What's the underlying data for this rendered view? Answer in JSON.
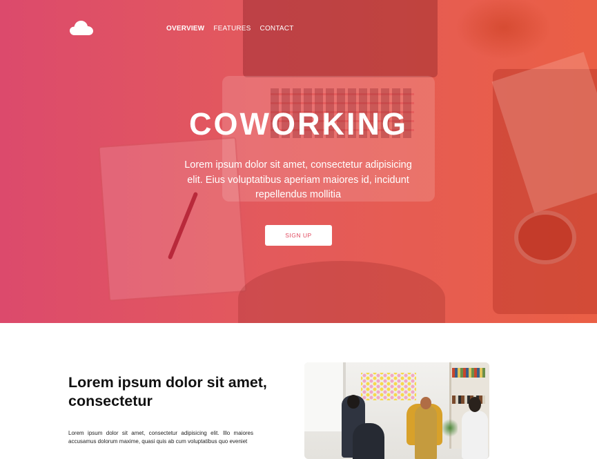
{
  "nav": {
    "logo_icon": "cloud-icon",
    "items": [
      {
        "label": "OVERVIEW",
        "active": true
      },
      {
        "label": "FEATURES",
        "active": false
      },
      {
        "label": "CONTACT",
        "active": false
      }
    ]
  },
  "hero": {
    "title": "COWORKING",
    "subtitle": "Lorem ipsum dolor sit amet, consectetur adipisicing elit. Eius voluptatibus aperiam maiores id, incidunt repellendus mollitia",
    "cta_label": "SIGN UP",
    "gradient_start": "#dc4a6c",
    "gradient_end": "#ea5f45"
  },
  "section": {
    "title": "Lorem ipsum dolor sit amet, consectetur",
    "body": "Lorem ipsum dolor sit amet, consectetur adipisicing elit. Illo maiores accusamus dolorum maxime, quasi quis ab cum voluptatibus quo eveniet"
  },
  "colors": {
    "accent": "#e0485e",
    "text_dark": "#111111",
    "background": "#ffffff"
  }
}
